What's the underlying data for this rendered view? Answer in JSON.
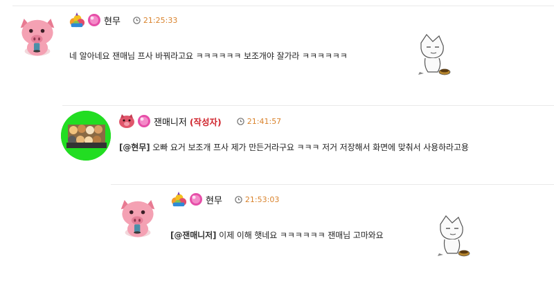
{
  "comments": [
    {
      "nickname": "현무",
      "author_tag": "",
      "time": "21:25:33",
      "mention": "",
      "text": "네 알아네요 잰매님 프사 바꿔라고요 ㅋㅋㅋㅋㅋㅋ 보조개야 잘가라 ㅋㅋㅋㅋㅋㅋ"
    },
    {
      "nickname": "잰매니저",
      "author_tag": "(작성자)",
      "time": "21:41:57",
      "mention": "[@현무]",
      "text": "오빠 요거 보조개 프사 제가 만든거라구요 ㅋㅋㅋ 저거 저장해서 화면에 맞춰서 사용하라고용"
    },
    {
      "nickname": "현무",
      "author_tag": "",
      "time": "21:53:03",
      "mention": "[@잰매니저]",
      "text": "이제 이해 햇네요 ㅋㅋㅋㅋㅋㅋ 잰매님 고마와요"
    }
  ],
  "icons": {
    "avatar_pig": "pink-pig-avatar",
    "avatar_group": "animal-group-avatar",
    "level_badge_fruit": "fruit-level-icon",
    "level_badge_pig": "pig-level-icon",
    "gem": "pink-gem-icon",
    "clock": "clock-icon",
    "sticker": "bowing-character-sticker"
  },
  "colors": {
    "author_tag": "#d0262e",
    "time": "#d9822b",
    "avatar_group_bg": "#22dd22"
  }
}
